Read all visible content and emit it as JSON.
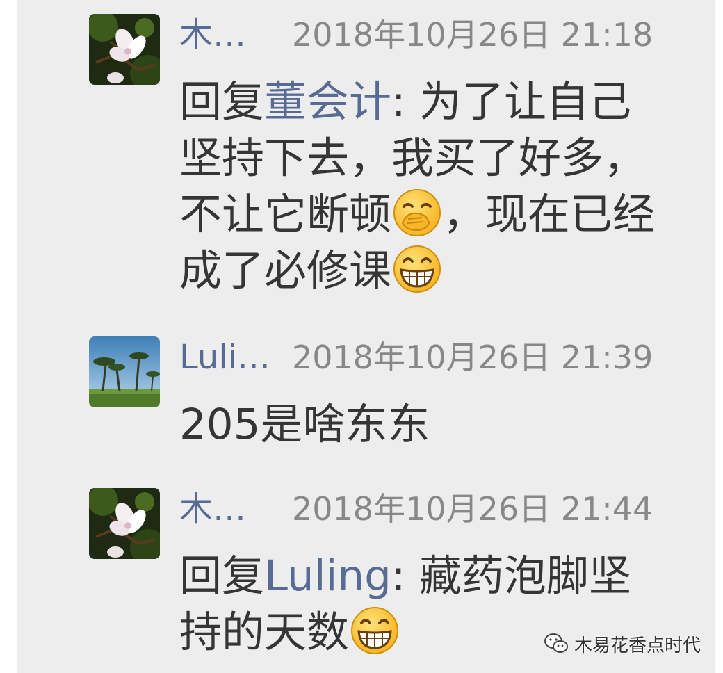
{
  "comments": [
    {
      "name": "木…",
      "time": "2018年10月26日 21:18",
      "reply_prefix": "回复",
      "mention": "董会计",
      "separator": ": ",
      "text": "为了让自己坚持下去，我买了好多，不让它断顿",
      "text_after_first_emoji": "，现在已经成了必修课",
      "emojis": [
        "hand-over-mouth-emoji",
        "grinning-emoji"
      ]
    },
    {
      "name": "Luli…",
      "time": "2018年10月26日 21:39",
      "text": "205是啥东东"
    },
    {
      "name": "木…",
      "time": "2018年10月26日 21:44",
      "reply_prefix": "回复",
      "mention": "Luling",
      "separator": ": ",
      "text": "藏药泡脚坚持的天数",
      "emojis": [
        "grinning-emoji"
      ]
    }
  ],
  "watermark": {
    "icon": "wechat-icon",
    "text": "木易花香点时代"
  },
  "colors": {
    "background": "#ededed",
    "name": "#576b95",
    "time": "#888888",
    "body_text": "#353535"
  }
}
